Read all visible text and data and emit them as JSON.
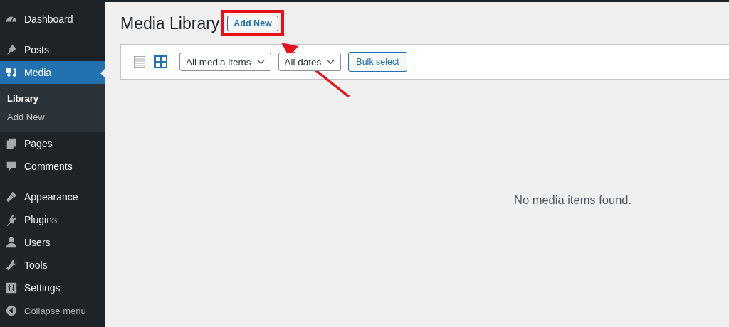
{
  "sidebar": {
    "sections": [
      {
        "items": [
          {
            "label": "Dashboard",
            "selected": false
          }
        ]
      },
      {
        "items": [
          {
            "label": "Posts",
            "selected": false
          },
          {
            "label": "Media",
            "selected": true,
            "children": [
              {
                "label": "Library",
                "selected": true
              },
              {
                "label": "Add New",
                "selected": false
              }
            ]
          },
          {
            "label": "Pages",
            "selected": false
          },
          {
            "label": "Comments",
            "selected": false
          }
        ]
      },
      {
        "items": [
          {
            "label": "Appearance",
            "selected": false
          },
          {
            "label": "Plugins",
            "selected": false
          },
          {
            "label": "Users",
            "selected": false
          },
          {
            "label": "Tools",
            "selected": false
          },
          {
            "label": "Settings",
            "selected": false
          }
        ]
      }
    ],
    "collapse_label": "Collapse menu"
  },
  "page": {
    "title": "Media Library",
    "add_button": "Add New"
  },
  "toolbar": {
    "view_modes": [
      {
        "selected": false
      },
      {
        "selected": true
      }
    ],
    "filters": [
      {
        "value": "All media items"
      },
      {
        "value": "All dates"
      }
    ],
    "bulk_button": "Bulk select"
  },
  "empty_message": "No media items found."
}
